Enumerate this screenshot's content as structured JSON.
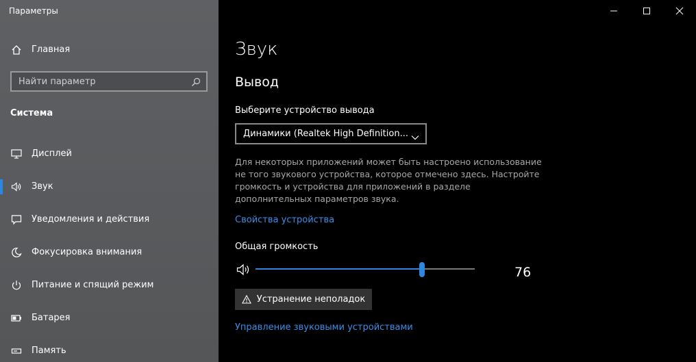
{
  "window": {
    "title": "Параметры",
    "minimize_icon": "minimize-icon",
    "maximize_icon": "maximize-icon",
    "close_icon": "close-icon"
  },
  "sidebar": {
    "home_label": "Главная",
    "home_icon": "home-icon",
    "search_placeholder": "Найти параметр",
    "search_icon": "search-icon",
    "section_title": "Система",
    "items": [
      {
        "label": "Дисплей",
        "icon": "display-icon",
        "selected": false
      },
      {
        "label": "Звук",
        "icon": "speaker-icon",
        "selected": true
      },
      {
        "label": "Уведомления и действия",
        "icon": "notification-icon",
        "selected": false
      },
      {
        "label": "Фокусировка внимания",
        "icon": "moon-icon",
        "selected": false
      },
      {
        "label": "Питание и спящий режим",
        "icon": "power-icon",
        "selected": false
      },
      {
        "label": "Батарея",
        "icon": "battery-icon",
        "selected": false
      },
      {
        "label": "Память",
        "icon": "storage-icon",
        "selected": false
      }
    ]
  },
  "main": {
    "title": "Звук",
    "section": "Вывод",
    "device_label": "Выберите устройство вывода",
    "device_selected": "Динамики (Realtek High Definition...",
    "description": "Для некоторых приложений может быть настроено использование не того звукового устройства, которое отмечено здесь. Настройте громкость и устройства для приложений в разделе дополнительных параметров звука.",
    "device_properties_link": "Свойства устройства",
    "volume_label": "Общая громкость",
    "volume_value": "76",
    "volume_level": 0.76,
    "troubleshoot_label": "Устранение неполадок",
    "manage_devices_link": "Управление звуковыми устройствами"
  },
  "colors": {
    "accent": "#2f86e0",
    "link": "#3a8ee8",
    "sidebar_bg": "#5a5c5f",
    "content_bg": "#000000"
  }
}
